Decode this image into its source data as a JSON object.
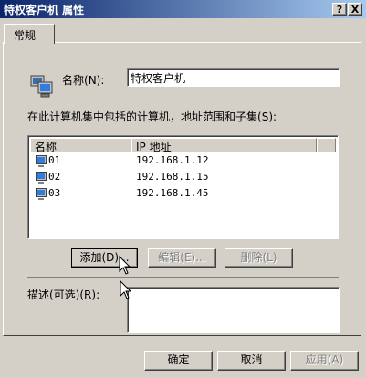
{
  "window": {
    "title": "特权客户机 属性",
    "help_button": "?",
    "close_button": "X"
  },
  "tabs": [
    {
      "label": "常规"
    }
  ],
  "name_field": {
    "label": "名称",
    "accel": "(N):",
    "value": "特权客户机"
  },
  "list_description": "在此计算机集中包括的计算机，地址范围和子集",
  "list_description_accel": "(S):",
  "computer_list": {
    "columns": [
      "名称",
      "IP 地址"
    ],
    "rows": [
      {
        "name": "01",
        "ip": "192.168.1.12"
      },
      {
        "name": "02",
        "ip": "192.168.1.15"
      },
      {
        "name": "03",
        "ip": "192.168.1.45"
      }
    ]
  },
  "list_buttons": {
    "add": "添加(D)...",
    "edit": "编辑(E)...",
    "delete": "删除(L)"
  },
  "description_field": {
    "label": "描述(可选)",
    "accel": "(R):",
    "value": ""
  },
  "dialog_buttons": {
    "ok": "确定",
    "cancel": "取消",
    "apply": "应用(A)"
  },
  "colors": {
    "titlebar": "#0a246a",
    "face": "#d4d0c8"
  }
}
